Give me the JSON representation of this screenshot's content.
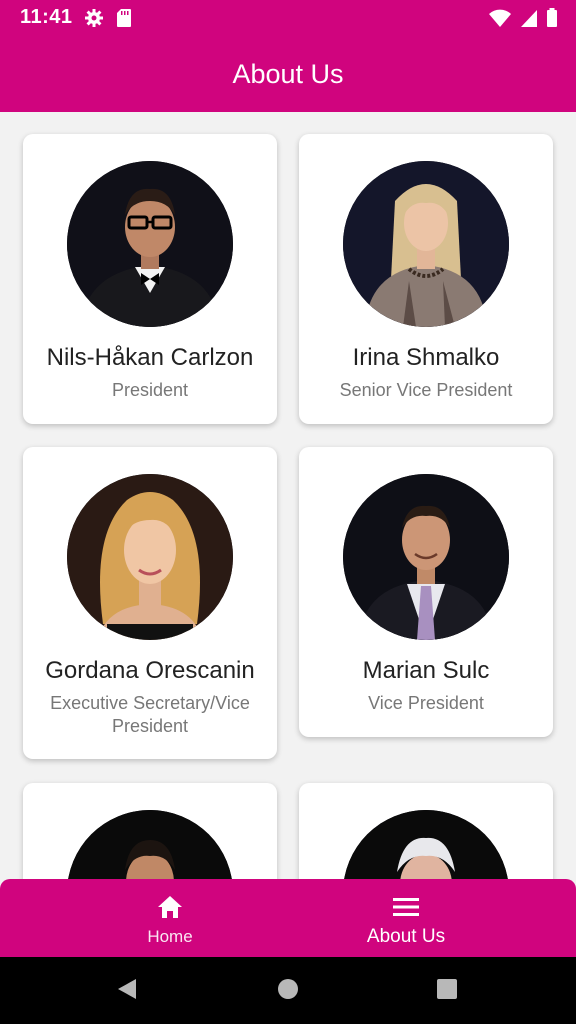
{
  "status_bar": {
    "time": "11:41",
    "left_icons": [
      "gear-icon",
      "sd-card-icon"
    ],
    "right_icons": [
      "wifi-icon",
      "signal-icon",
      "battery-icon"
    ]
  },
  "app_bar": {
    "title": "About Us"
  },
  "members": [
    {
      "name": "Nils-Håkan Carlzon",
      "role": "President",
      "photo": "avatar-photo"
    },
    {
      "name": "Irina Shmalko",
      "role": "Senior Vice President",
      "photo": "avatar-photo"
    },
    {
      "name": "Gordana Orescanin",
      "role": "Executive Secretary/Vice President",
      "photo": "avatar-photo"
    },
    {
      "name": "Marian Sulc",
      "role": "Vice President",
      "photo": "avatar-photo"
    },
    {
      "name": "",
      "role": "",
      "photo": "avatar-photo"
    },
    {
      "name": "",
      "role": "",
      "photo": "avatar-photo"
    }
  ],
  "bottom_nav": {
    "items": [
      {
        "label": "Home",
        "icon": "home-icon",
        "active": false
      },
      {
        "label": "About Us",
        "icon": "menu-icon",
        "active": true
      }
    ]
  },
  "system_nav": [
    "back-icon",
    "home-circle-icon",
    "recents-icon"
  ],
  "colors": {
    "primary": "#d0047e",
    "background": "#f2f2f2",
    "card": "#ffffff",
    "role_text": "#777777"
  }
}
